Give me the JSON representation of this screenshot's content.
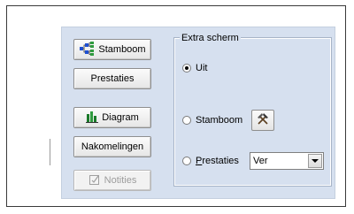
{
  "buttons": {
    "stamboom": "Stamboom",
    "prestaties": "Prestaties",
    "diagram": "Diagram",
    "nakomelingen": "Nakomelingen",
    "notities": "Notities"
  },
  "extra_scherm": {
    "title": "Extra scherm",
    "options": [
      {
        "label": "Uit",
        "checked": true
      },
      {
        "label": "Stamboom",
        "checked": false
      },
      {
        "label": "Prestaties",
        "checked": false
      }
    ],
    "prestaties_select_value": "Ver"
  },
  "icons": {
    "stamboom": "pedigree-tree-icon",
    "diagram": "bar-chart-icon",
    "notities": "note-icon",
    "tool": "hammer-pick-icon",
    "dropdown": "chevron-down-icon"
  },
  "colors": {
    "panel_bg": "#d6e0ef",
    "tree_blue": "#1f4fd1",
    "tree_green": "#2f9b3f"
  }
}
